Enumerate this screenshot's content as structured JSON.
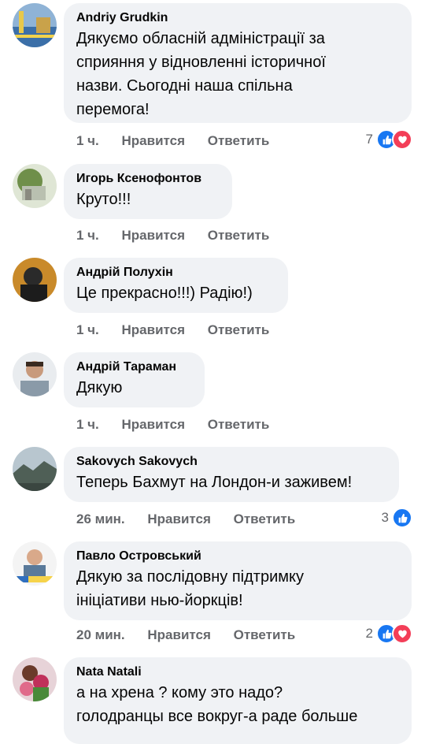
{
  "colors": {
    "bubble": "#f0f2f5",
    "meta": "#65676b",
    "like": "#1877f2",
    "love": "#f33e58"
  },
  "comments": [
    {
      "author": "Andriy Grudkin",
      "lines": [
        "Дякуємо обласній адміністрації за",
        "сприяння у відновленні історичної",
        "назви. Сьогодні наша спільна",
        "перемога!"
      ],
      "time": "1 ч.",
      "like": "Нравится",
      "reply": "Ответить",
      "reactions_count": "7",
      "reactions": [
        "like-icon",
        "love-icon"
      ]
    },
    {
      "author": "Игорь Ксенофонтов",
      "lines": [
        "Круто!!!"
      ],
      "time": "1 ч.",
      "like": "Нравится",
      "reply": "Ответить"
    },
    {
      "author": "Андрій Полухін",
      "lines": [
        "Це прекрасно!!!) Радію!)"
      ],
      "time": "1 ч.",
      "like": "Нравится",
      "reply": "Ответить"
    },
    {
      "author": "Андрій Тараман",
      "lines": [
        "Дякую"
      ],
      "time": "1 ч.",
      "like": "Нравится",
      "reply": "Ответить"
    },
    {
      "author": "Sakovych Sakovych",
      "lines": [
        "Теперь Бахмут на Лондон-и заживем!"
      ],
      "time": "26 мин.",
      "like": "Нравится",
      "reply": "Ответить",
      "reactions_count": "3",
      "reactions": [
        "like-icon"
      ]
    },
    {
      "author": "Павло Островський",
      "lines": [
        "Дякую за послідовну підтримку",
        "ініціативи нью-йоркців!"
      ],
      "time": "20 мин.",
      "like": "Нравится",
      "reply": "Ответить",
      "reactions_count": "2",
      "reactions": [
        "like-icon",
        "love-icon"
      ]
    },
    {
      "author": "Nata Natali",
      "lines": [
        "а на хрена ? кому это надо?",
        "голодранцы все вокруг-а раде больше"
      ]
    }
  ]
}
